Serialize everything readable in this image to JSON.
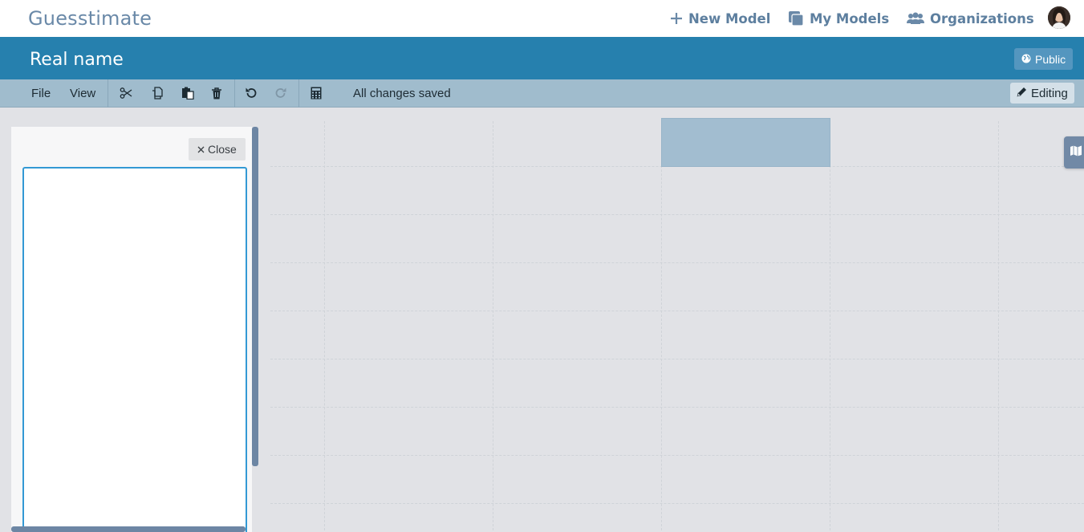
{
  "app": {
    "brand": "Guesstimate"
  },
  "nav": {
    "new_model": "New Model",
    "my_models": "My Models",
    "organizations": "Organizations"
  },
  "model": {
    "title": "Real name",
    "visibility": "Public"
  },
  "toolbar": {
    "file": "File",
    "view": "View",
    "icons": [
      "cut-icon",
      "copy-icon",
      "paste-icon",
      "delete-icon",
      "undo-icon",
      "redo-icon",
      "calculator-icon"
    ],
    "status": "All changes saved",
    "mode": "Editing"
  },
  "sidepanel": {
    "close_label": "Close",
    "editor_value": ""
  },
  "colors": {
    "titlebar": "#2680ae",
    "toolbar": "#a0bccd",
    "brand_text": "#6a89a8",
    "canvas": "#e1e2e6",
    "selected_cell": "#a2bdd0",
    "scrollbar": "#6d86a4",
    "editor_border": "#3399d4"
  }
}
